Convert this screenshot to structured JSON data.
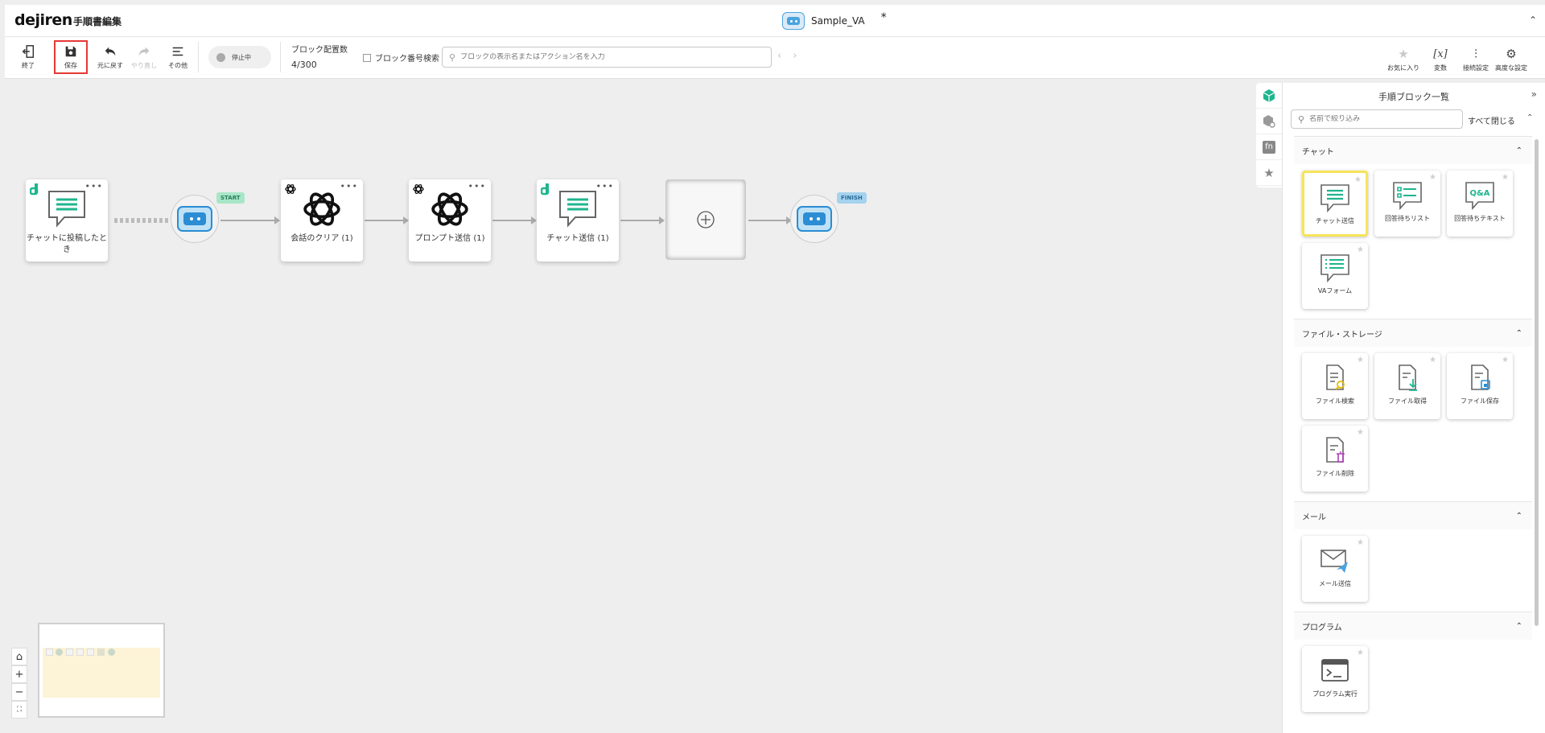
{
  "app": {
    "logo": "dejiren",
    "page_heading": "手順書編集"
  },
  "flow": {
    "name": "Sample_VA",
    "unsaved_mark": "*"
  },
  "toolbar": {
    "exit_label": "終了",
    "save_label": "保存",
    "undo_label": "元に戻す",
    "redo_label": "やり直し",
    "other_label": "その他",
    "status_label": "停止中",
    "block_count_label": "ブロック配置数",
    "block_count_value": "4/300",
    "block_number_search_label": "ブロック番号検索",
    "search_placeholder": "ブロックの表示名またはアクション名を入力",
    "favorites_label": "お気に入り",
    "variables_label": "変数",
    "connection_settings_label": "接続設定",
    "advanced_settings_label": "高度な設定"
  },
  "canvas": {
    "blocks": [
      {
        "label": "チャットに投稿したとき"
      },
      {
        "label": "会話のクリア (1)"
      },
      {
        "label": "プロンプト送信 (1)"
      },
      {
        "label": "チャット送信 (1)"
      }
    ],
    "start_tag": "START",
    "finish_tag": "FINISH"
  },
  "panel": {
    "title": "手順ブロック一覧",
    "filter_placeholder": "名前で絞り込み",
    "collapse_all": "すべて閉じる",
    "sections": [
      {
        "title": "チャット",
        "items": [
          "チャット送信",
          "回答待ちリスト",
          "回答待ちテキスト",
          "VAフォーム"
        ]
      },
      {
        "title": "ファイル・ストレージ",
        "items": [
          "ファイル検索",
          "ファイル取得",
          "ファイル保存",
          "ファイル削除"
        ]
      },
      {
        "title": "メール",
        "items": [
          "メール送信"
        ]
      },
      {
        "title": "プログラム",
        "items": [
          "プログラム実行"
        ]
      }
    ]
  },
  "colors": {
    "accent_green": "#1fb58f",
    "bot_blue": "#2b8dd4",
    "save_highlight": "#e53935",
    "selected_card": "#f7e45a"
  }
}
